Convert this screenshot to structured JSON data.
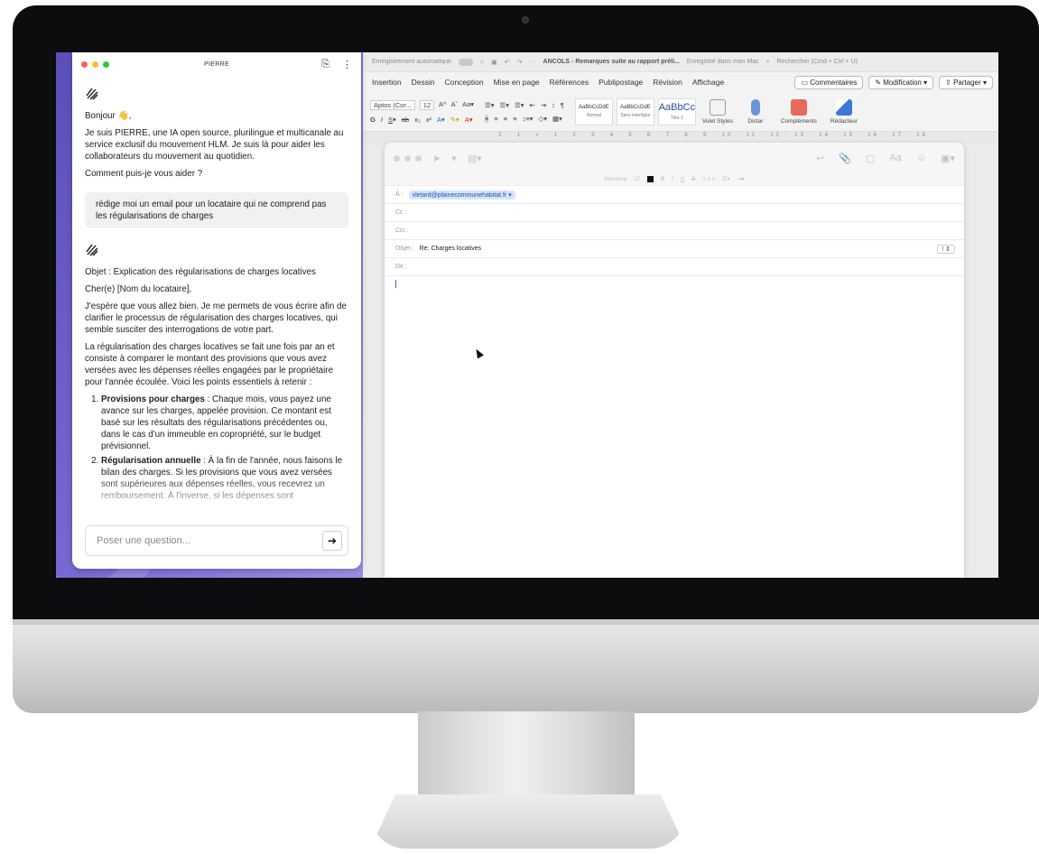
{
  "chat": {
    "title": "PIERRE",
    "greeting": "Bonjour 👋,",
    "intro": "Je suis PIERRE, une IA open source, plurilingue et multicanale au service exclusif du mouvement HLM. Je suis là pour aider les collaborateurs du mouvement au quotidien.",
    "question": "Comment puis-je vous aider ?",
    "user_message": "rédige moi un email pour un locataire qui ne comprend pas les régularisations de charges",
    "response": {
      "subject": "Objet : Explication des régularisations de charges locatives",
      "salutation": "Cher(e) [Nom du locataire],",
      "p1": "J'espère que vous allez bien. Je me permets de vous écrire afin de clarifier le processus de régularisation des charges locatives, qui semble susciter des interrogations de votre part.",
      "p2": "La régularisation des charges locatives se fait une fois par an et consiste à comparer le montant des provisions que vous avez versées avec les dépenses réelles engagées par le propriétaire pour l'année écoulée. Voici les points essentiels à retenir :",
      "items": [
        {
          "title": "Provisions pour charges",
          "text": " : Chaque mois, vous payez une avance sur les charges, appelée provision. Ce montant est basé sur les résultats des régularisations précédentes ou, dans le cas d'un immeuble en copropriété, sur le budget prévisionnel."
        },
        {
          "title": "Régularisation annuelle",
          "text": " : À la fin de l'année, nous faisons le bilan des charges. Si les provisions que vous avez versées sont supérieures aux dépenses réelles, vous recevrez un remboursement. À l'inverse, si les dépenses sont"
        }
      ]
    },
    "input_placeholder": "Poser une question..."
  },
  "word": {
    "autosave": "Enregistrement automatique",
    "doc_title": "ANCOLS - Remarques suite au rapport préli...",
    "saved": "Enregistré dans mon Mac",
    "search_placeholder": "Rechercher (Cmd + Ctrl + U)",
    "tabs": [
      "Insertion",
      "Dessin",
      "Conception",
      "Mise en page",
      "Références",
      "Publipostage",
      "Révision",
      "Affichage"
    ],
    "comments_label": "Commentaires",
    "modification_label": "Modification",
    "share_label": "Partager",
    "font_name": "Aptos (Cor...",
    "font_size": "12",
    "styles": [
      {
        "preview": "AaBbCcDdE",
        "name": "Normal"
      },
      {
        "preview": "AaBbCcDdE",
        "name": "Sans interligne"
      },
      {
        "preview": "AaBbCc",
        "name": "Titre 1"
      }
    ],
    "buttons": [
      "Volet Styles",
      "Dictar",
      "Compléments",
      "Rédacteur"
    ]
  },
  "mail": {
    "font": "Helvetica",
    "font_size": "12",
    "to_label": "À :",
    "to_value": "vletard@plainecommunehabitat.fr",
    "cc_label": "Cc :",
    "bcc_label": "Cci :",
    "subject_label": "Objet :",
    "subject_value": "Re: Charges locatives",
    "from_label": "De :",
    "priority": "!"
  },
  "colors": {
    "wallpaper": "#6e63c8",
    "chip": "#d6e5fb",
    "traffic_red": "#ff5f57",
    "traffic_yellow": "#febc2e",
    "traffic_green": "#28c840"
  }
}
